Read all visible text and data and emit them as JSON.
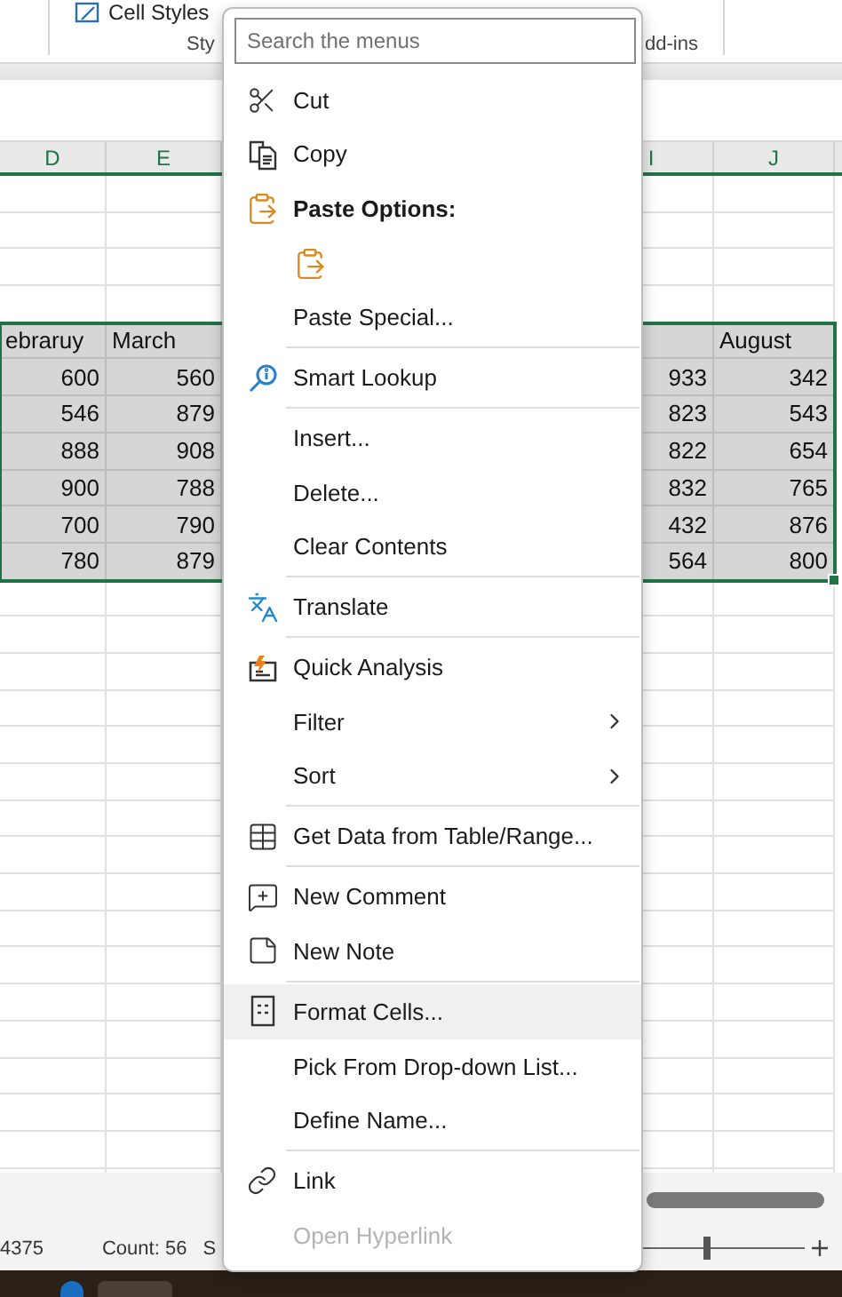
{
  "ribbon": {
    "cell_styles": "Cell Styles",
    "group_labels": [
      "Sty",
      "dd-ins"
    ]
  },
  "sheet": {
    "column_headers": [
      "D",
      "E",
      "I",
      "J"
    ],
    "table": {
      "columns": [
        {
          "label": "ebraruy"
        },
        {
          "label": "March"
        },
        {},
        {
          "label": "August"
        }
      ],
      "rows": [
        [
          "600",
          "560",
          "933",
          "342"
        ],
        [
          "546",
          "879",
          "823",
          "543"
        ],
        [
          "888",
          "908",
          "822",
          "654"
        ],
        [
          "900",
          "788",
          "832",
          "765"
        ],
        [
          "700",
          "790",
          "432",
          "876"
        ],
        [
          "780",
          "879",
          "564",
          "800"
        ]
      ]
    }
  },
  "status_bar": {
    "items": [
      "4375",
      "Count: 56",
      "S"
    ],
    "zoom_slider": {
      "level": 0.4
    }
  },
  "context_menu": {
    "search": {
      "placeholder": "Search the menus"
    },
    "items": [
      {
        "kind": "item",
        "label": "Cut"
      },
      {
        "kind": "item",
        "label": "Copy"
      },
      {
        "kind": "header",
        "label": "Paste Options:"
      },
      {
        "kind": "paste-option"
      },
      {
        "kind": "item",
        "label": "Paste Special..."
      },
      {
        "kind": "separator"
      },
      {
        "kind": "item",
        "label": "Smart Lookup"
      },
      {
        "kind": "separator"
      },
      {
        "kind": "item",
        "label": "Insert..."
      },
      {
        "kind": "item",
        "label": "Delete..."
      },
      {
        "kind": "item",
        "label": "Clear Contents"
      },
      {
        "kind": "separator"
      },
      {
        "kind": "item",
        "label": "Translate"
      },
      {
        "kind": "separator"
      },
      {
        "kind": "item",
        "label": "Quick Analysis"
      },
      {
        "kind": "item",
        "label": "Filter",
        "submenu": true
      },
      {
        "kind": "item",
        "label": "Sort",
        "submenu": true
      },
      {
        "kind": "separator"
      },
      {
        "kind": "item",
        "label": "Get Data from Table/Range..."
      },
      {
        "kind": "separator"
      },
      {
        "kind": "item",
        "label": "New Comment"
      },
      {
        "kind": "item",
        "label": "New Note"
      },
      {
        "kind": "separator"
      },
      {
        "kind": "item",
        "label": "Format Cells...",
        "highlighted": true
      },
      {
        "kind": "item",
        "label": "Pick From Drop-down List..."
      },
      {
        "kind": "item",
        "label": "Define Name..."
      },
      {
        "kind": "separator"
      },
      {
        "kind": "item",
        "label": "Link"
      },
      {
        "kind": "item",
        "label": "Open Hyperlink",
        "disabled": true
      }
    ]
  }
}
